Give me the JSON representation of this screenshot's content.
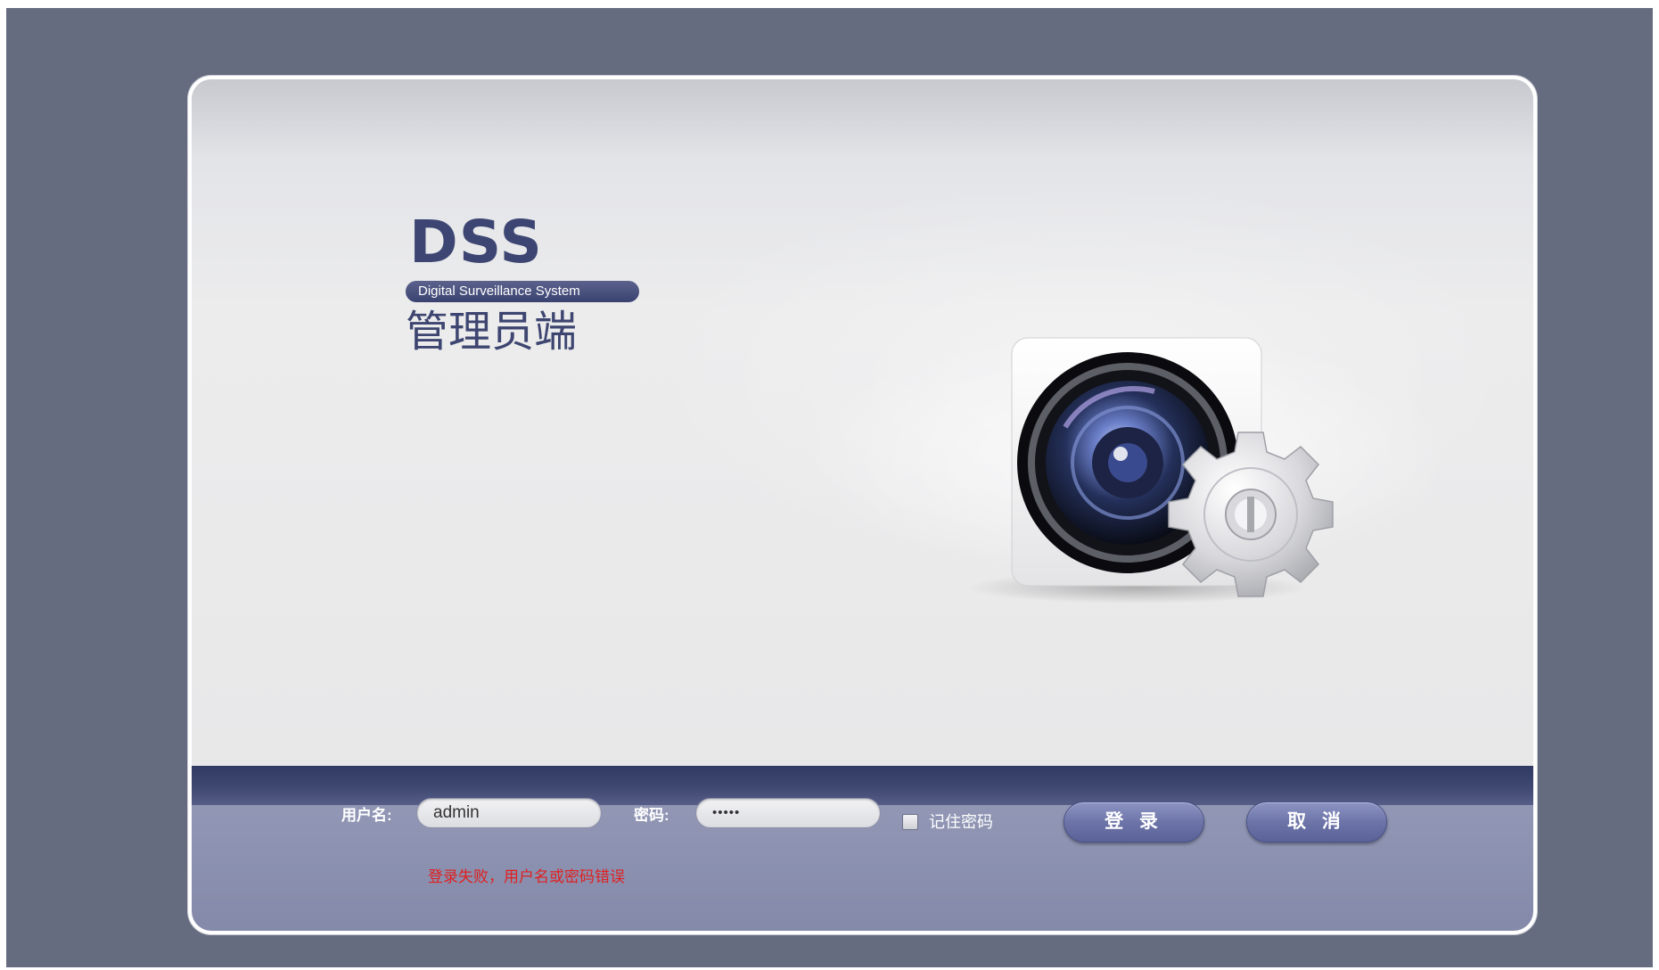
{
  "branding": {
    "product_short": "DSS",
    "product_full": "Digital Surveillance System",
    "client_name": "管理员端"
  },
  "login_form": {
    "username_label": "用户名:",
    "username_value": "admin",
    "password_label": "密码:",
    "password_value": "•••••",
    "remember_label": "记住密码",
    "remember_checked": false,
    "login_button": "登 录",
    "cancel_button": "取 消",
    "error_message": "登录失败，用户名或密码错误"
  },
  "icons": {
    "hero": "camera-lens-gear-icon",
    "remember": "checkbox-icon"
  },
  "colors": {
    "background": "#666c80",
    "brand": "#3d4673",
    "button": "#6a72a6",
    "error": "#e0201f"
  }
}
